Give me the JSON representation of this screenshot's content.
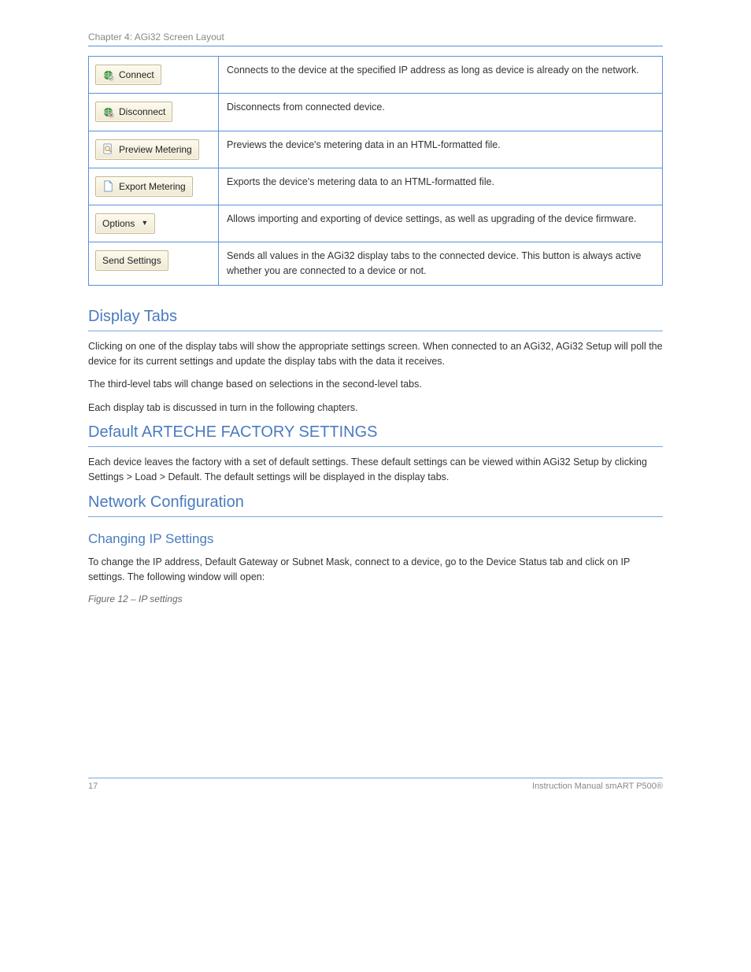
{
  "chapter": "Chapter 4: AGi32 Screen Layout",
  "table": {
    "rows": [
      {
        "btn": {
          "icon": "globe",
          "label": "Connect"
        },
        "desc": "Connects to the device at the specified IP address as long as device is already on the network."
      },
      {
        "btn": {
          "icon": "globe",
          "label": "Disconnect"
        },
        "desc": "Disconnects from connected device."
      },
      {
        "btn": {
          "icon": "magnifier",
          "label": "Preview Metering"
        },
        "desc": "Previews the device's metering data in an HTML-formatted file."
      },
      {
        "btn": {
          "icon": "page",
          "label": "Export Metering"
        },
        "desc": "Exports the device's metering data to an HTML-formatted file."
      },
      {
        "btn": {
          "icon": "none",
          "label": "Options",
          "caret": true
        },
        "desc": "Allows importing and exporting of device settings, as well as upgrading of the device firmware."
      },
      {
        "btn": {
          "icon": "none",
          "label": "Send Settings"
        },
        "desc": "Sends all values in the AGi32 display tabs to the connected device. This button is always active whether you are connected to a device or not."
      }
    ]
  },
  "section_tabs": {
    "title": "Display Tabs",
    "paras": [
      "Clicking on one of the display tabs will show the appropriate settings screen. When connected to an AGi32, AGi32 Setup will poll the device for its current settings and update the display tabs with the data it receives.",
      "The third-level tabs will change based on selections in the second-level tabs.",
      "Each display tab is discussed in turn in the following chapters."
    ]
  },
  "section_default": {
    "title": "Default ARTECHE FACTORY SETTINGS",
    "para": "Each device leaves the factory with a set of default settings. These default settings can be viewed within AGi32 Setup by clicking Settings > Load > Default. The default settings will be displayed in the display tabs."
  },
  "section_network": {
    "title": "Network Configuration",
    "subtitle": "Changing IP Settings",
    "para": "To change the IP address, Default Gateway or Subnet Mask, connect to a device, go to the Device Status tab and click on IP settings. The following window will open:",
    "figcap": "Figure 12 – IP settings"
  },
  "footer": {
    "page": "17",
    "brand": "Instruction Manual smART P500®"
  }
}
